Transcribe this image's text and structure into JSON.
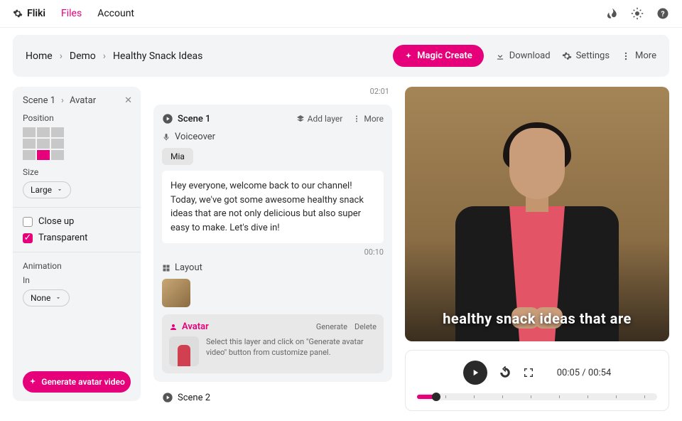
{
  "brand": "Fliki",
  "nav": {
    "files": "Files",
    "account": "Account"
  },
  "breadcrumbs": {
    "home": "Home",
    "folder": "Demo",
    "file": "Healthy Snack Ideas"
  },
  "header": {
    "magic": "Magic Create",
    "download": "Download",
    "settings": "Settings",
    "more": "More"
  },
  "left": {
    "crumb_scene": "Scene 1",
    "crumb_avatar": "Avatar",
    "position_label": "Position",
    "size_label": "Size",
    "size_value": "Large",
    "closeup_label": "Close up",
    "transparent_label": "Transparent",
    "animation_label": "Animation",
    "in_label": "In",
    "in_value": "None",
    "generate_btn": "Generate avatar video"
  },
  "mid": {
    "top_time": "02:01",
    "scene1_title": "Scene 1",
    "add_layer": "Add layer",
    "more": "More",
    "voiceover_label": "Voiceover",
    "voice_name": "Mia",
    "script": "Hey everyone, welcome back to our channel! Today, we've got some awesome healthy snack ideas that are not only delicious but also super easy to make. Let's dive in!",
    "duration": "00:10",
    "layout_label": "Layout",
    "avatar_label": "Avatar",
    "generate": "Generate",
    "delete": "Delete",
    "avatar_hint": "Select this layer and click on \"Generate avatar video\" button from customize panel.",
    "scene2_title": "Scene 2"
  },
  "preview": {
    "caption": "healthy snack ideas that are"
  },
  "player": {
    "current": "00:05",
    "total": "00:54"
  }
}
